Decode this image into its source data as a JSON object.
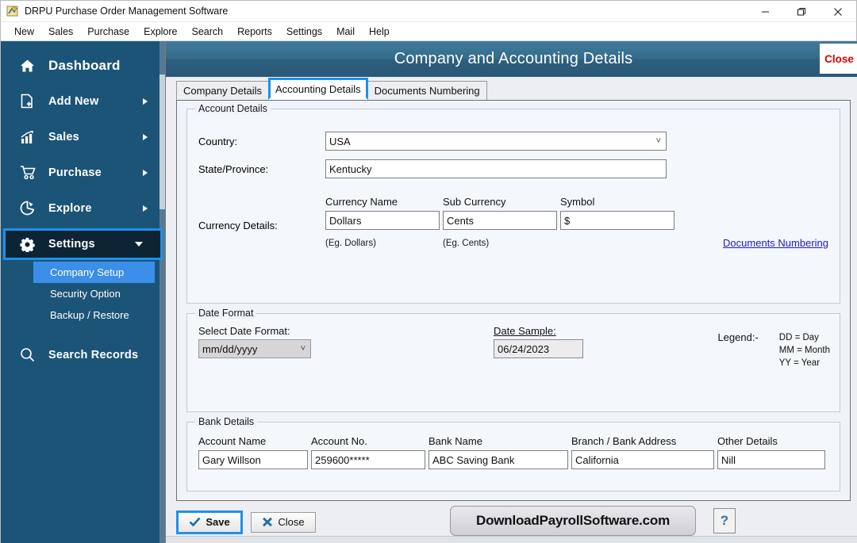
{
  "window": {
    "title": "DRPU Purchase Order Management Software",
    "app_icon": "app-logo-icon",
    "minimize": "minimize-icon",
    "maximize": "maximize-icon",
    "close": "close-icon"
  },
  "menubar": {
    "items": [
      {
        "label": "New"
      },
      {
        "label": "Sales"
      },
      {
        "label": "Purchase"
      },
      {
        "label": "Explore"
      },
      {
        "label": "Search"
      },
      {
        "label": "Reports"
      },
      {
        "label": "Settings"
      },
      {
        "label": "Mail"
      },
      {
        "label": "Help"
      }
    ]
  },
  "sidebar": {
    "items": [
      {
        "label": "Dashboard",
        "icon": "home-icon",
        "arrow": "none",
        "active": false
      },
      {
        "label": "Add New",
        "icon": "file-add-icon",
        "arrow": "right",
        "active": false
      },
      {
        "label": "Sales",
        "icon": "bar-chart-icon",
        "arrow": "right",
        "active": false
      },
      {
        "label": "Purchase",
        "icon": "cart-icon",
        "arrow": "right",
        "active": false
      },
      {
        "label": "Explore",
        "icon": "pie-chart-icon",
        "arrow": "right",
        "active": false
      },
      {
        "label": "Settings",
        "icon": "gear-icon",
        "arrow": "down",
        "active": true
      }
    ],
    "submenu": [
      {
        "label": "Company Setup",
        "selected": true
      },
      {
        "label": "Security Option",
        "selected": false
      },
      {
        "label": "Backup / Restore",
        "selected": false
      }
    ],
    "footer_item": {
      "label": "Search Records",
      "icon": "search-icon"
    },
    "colors": {
      "bg": "#1c5478",
      "active_bg": "#0d2435",
      "accent": "#1e90e8",
      "selected_bg": "#3b8fe8"
    }
  },
  "header": {
    "title": "Company and Accounting Details",
    "close_label": "Close",
    "close_color": "#e00000"
  },
  "tabs": [
    {
      "label": "Company Details",
      "active": false
    },
    {
      "label": "Accounting Details",
      "active": true
    },
    {
      "label": "Documents Numbering",
      "active": false
    }
  ],
  "account_details": {
    "group_title": "Account Details",
    "country_label": "Country:",
    "country_value": "USA",
    "state_label": "State/Province:",
    "state_value": "Kentucky",
    "currency_label": "Currency Details:",
    "currency_name_header": "Currency Name",
    "sub_currency_header": "Sub Currency",
    "symbol_header": "Symbol",
    "currency_name_value": "Dollars",
    "sub_currency_value": "Cents",
    "symbol_value": "$",
    "currency_name_hint": "(Eg. Dollars)",
    "sub_currency_hint": "(Eg. Cents)",
    "documents_numbering_link": "Documents Numbering"
  },
  "date_format": {
    "group_title": "Date Format",
    "select_label": "Select Date Format:",
    "select_value": "mm/dd/yyyy",
    "sample_label": "Date Sample:",
    "sample_value": "06/24/2023",
    "legend_title": "Legend:-",
    "legend_items": [
      "DD = Day",
      "MM = Month",
      "YY = Year"
    ]
  },
  "bank_details": {
    "group_title": "Bank Details",
    "columns": [
      "Account Name",
      "Account No.",
      "Bank Name",
      "Branch / Bank Address",
      "Other Details"
    ],
    "values": [
      "Gary Willson",
      "259600*****",
      "ABC Saving Bank",
      "California",
      "Nill"
    ]
  },
  "bottombar": {
    "save_label": "Save",
    "save_icon": "check-icon",
    "close_label": "Close",
    "close_icon": "x-icon",
    "watermark": "DownloadPayrollSoftware.com",
    "help_label": "?"
  }
}
